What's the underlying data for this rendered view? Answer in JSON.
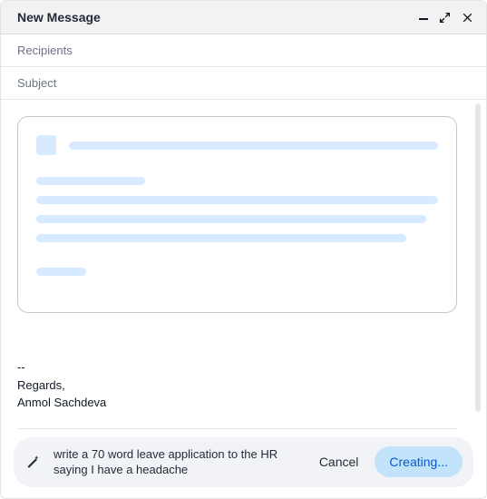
{
  "header": {
    "title": "New Message"
  },
  "fields": {
    "recipients_placeholder": "Recipients",
    "subject_placeholder": "Subject"
  },
  "signature": {
    "sep": "--",
    "line1": "Regards,",
    "line2": "Anmol Sachdeva"
  },
  "prompt": {
    "text": "write a 70 word leave application to the HR saying I have a headache",
    "cancel": "Cancel",
    "creating": "Creating..."
  }
}
